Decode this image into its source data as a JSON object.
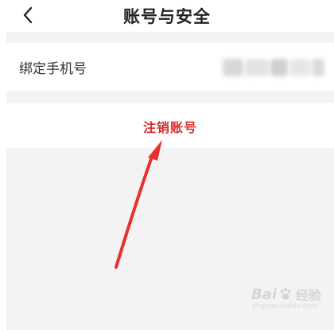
{
  "header": {
    "title": "账号与安全",
    "back_icon": "chevron-left-icon"
  },
  "settings": {
    "bind_phone_label": "绑定手机号",
    "bind_phone_value_state": "blurred",
    "cancel_account_label": "注销账号"
  },
  "annotation": {
    "arrow_color": "#e8312f",
    "arrow_points_to": "cancel-account-row"
  },
  "watermark": {
    "text": "Bai",
    "paw_icon": "paw-icon",
    "suffix": "经验",
    "url": "jingyan.baidu.com"
  },
  "colors": {
    "accent": "#d92b2b",
    "background": "#f3f3f3",
    "text": "#333333"
  }
}
